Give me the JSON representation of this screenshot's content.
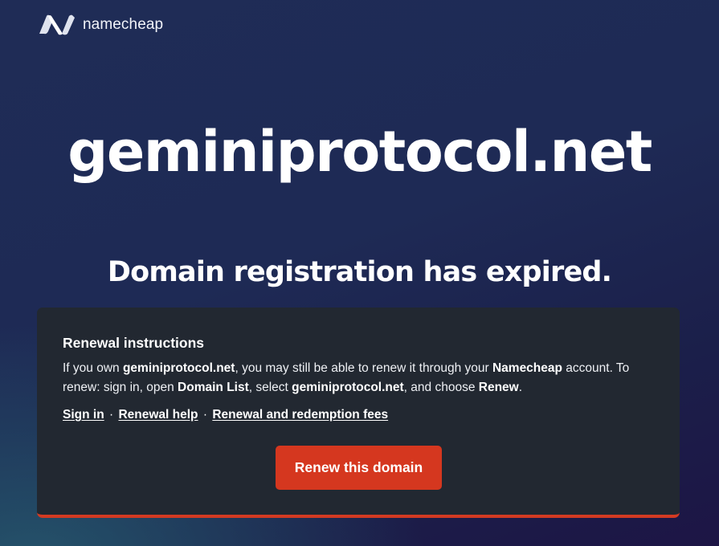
{
  "brand": {
    "name": "namecheap",
    "logo_icon": "namecheap-n-logo"
  },
  "domain": "geminiprotocol.net",
  "status_heading": "Domain registration has expired.",
  "renewal": {
    "heading": "Renewal instructions",
    "text_1": "If you own ",
    "domain": "geminiprotocol.net",
    "text_2": ", you may still be able to renew it through your ",
    "provider": "Namecheap",
    "text_3": " account. To renew: sign in, open ",
    "domain_list": "Domain List",
    "text_4": ", select ",
    "text_5": ", and choose ",
    "renew_word": "Renew",
    "text_6": ".",
    "links": {
      "sign_in": "Sign in",
      "renewal_help": "Renewal help",
      "fees": "Renewal and redemption fees",
      "separator": "·"
    },
    "button_label": "Renew this domain"
  },
  "colors": {
    "accent": "#d5371f",
    "card_background": "#222831",
    "page_background": "#1e2a55"
  }
}
